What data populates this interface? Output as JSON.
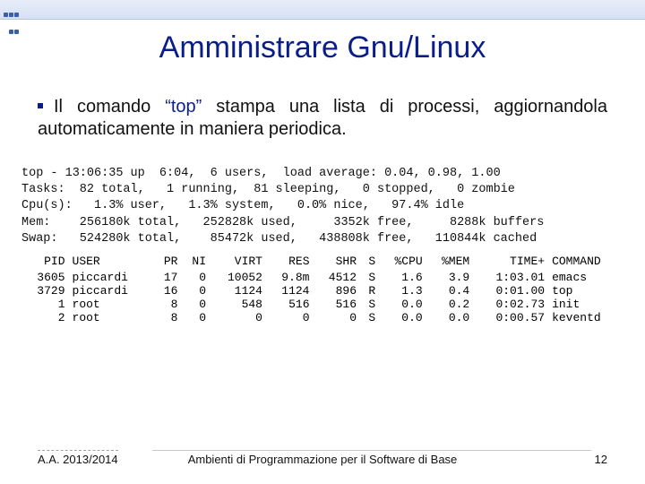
{
  "title": "Amministrare Gnu/Linux",
  "bullet": {
    "pre": "Il comando ",
    "quoted": "“top”",
    "post": " stampa una lista di processi, aggiornandola automaticamente in maniera periodica."
  },
  "top_output": {
    "line1": "top - 13:06:35 up  6:04,  6 users,  load average: 0.04, 0.98, 1.00",
    "line2": "Tasks:  82 total,   1 running,  81 sleeping,   0 stopped,   0 zombie",
    "line3": "Cpu(s):   1.3% user,   1.3% system,   0.0% nice,   97.4% idle",
    "line4": "Mem:    256180k total,   252828k used,     3352k free,     8288k buffers",
    "line5": "Swap:   524280k total,    85472k used,   438808k free,   110844k cached"
  },
  "headers": {
    "pid": "PID",
    "user": "USER",
    "pr": "PR",
    "ni": "NI",
    "virt": "VIRT",
    "res": "RES",
    "shr": "SHR",
    "s": "S",
    "cpu": "%CPU",
    "mem": "%MEM",
    "time": "TIME+",
    "cmd": "COMMAND"
  },
  "rows": [
    {
      "pid": "3605",
      "user": "piccardi",
      "pr": "17",
      "ni": "0",
      "virt": "10052",
      "res": "9.8m",
      "shr": "4512",
      "s": "S",
      "cpu": "1.6",
      "mem": "3.9",
      "time": "1:03.01",
      "cmd": "emacs"
    },
    {
      "pid": "3729",
      "user": "piccardi",
      "pr": "16",
      "ni": "0",
      "virt": "1124",
      "res": "1124",
      "shr": "896",
      "s": "R",
      "cpu": "1.3",
      "mem": "0.4",
      "time": "0:01.00",
      "cmd": "top"
    },
    {
      "pid": "1",
      "user": "root",
      "pr": "8",
      "ni": "0",
      "virt": "548",
      "res": "516",
      "shr": "516",
      "s": "S",
      "cpu": "0.0",
      "mem": "0.2",
      "time": "0:02.73",
      "cmd": "init"
    },
    {
      "pid": "2",
      "user": "root",
      "pr": "8",
      "ni": "0",
      "virt": "0",
      "res": "0",
      "shr": "0",
      "s": "S",
      "cpu": "0.0",
      "mem": "0.0",
      "time": "0:00.57",
      "cmd": "keventd"
    }
  ],
  "footer": {
    "left": "A.A. 2013/2014",
    "center": "Ambienti di Programmazione per il Software di Base",
    "right": "12"
  }
}
